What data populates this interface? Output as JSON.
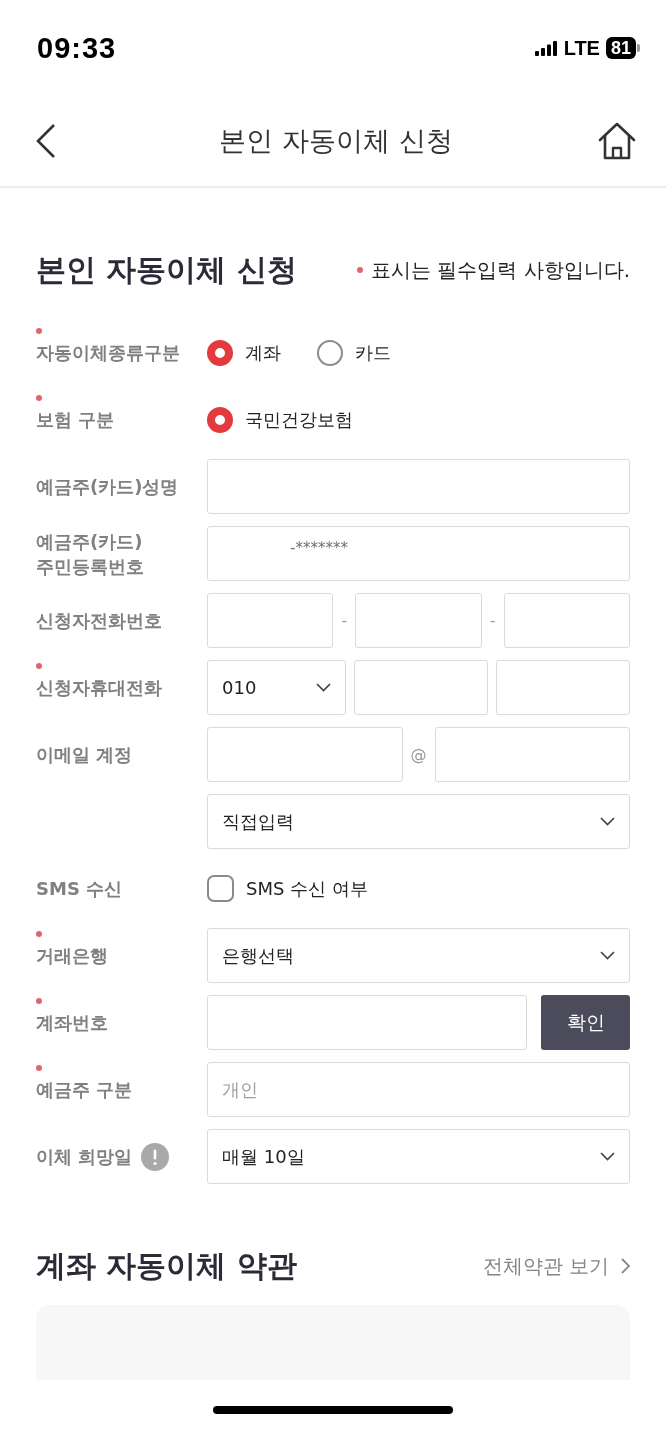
{
  "status_bar": {
    "time": "09:33",
    "network": "LTE",
    "battery": "81"
  },
  "header": {
    "title": "본인 자동이체 신청"
  },
  "form": {
    "title": "본인 자동이체 신청",
    "required_note": "표시는 필수입력 사항입니다.",
    "rows": [
      {
        "kind": "radio",
        "label": "자동이체종류구분",
        "required": true,
        "info": false,
        "options": [
          {
            "label": "계좌",
            "selected": true
          },
          {
            "label": "카드",
            "selected": false
          }
        ]
      },
      {
        "kind": "radio",
        "label": "보험 구분",
        "required": true,
        "info": false,
        "options": [
          {
            "label": "국민건강보험",
            "selected": true
          }
        ]
      },
      {
        "kind": "fields",
        "label": "예금주(카드)성명",
        "required": false,
        "info": false,
        "fields": [
          {
            "kind": "input"
          }
        ]
      },
      {
        "kind": "fields",
        "label": "예금주(카드) 주민등록번호",
        "required": false,
        "info": false,
        "fields": [
          {
            "kind": "input",
            "value": "-*******"
          }
        ]
      },
      {
        "kind": "fields",
        "label": "신청자전화번호",
        "required": false,
        "info": false,
        "fields": [
          {
            "kind": "input"
          },
          {
            "kind": "separator",
            "text": "-"
          },
          {
            "kind": "input"
          },
          {
            "kind": "separator",
            "text": "-"
          },
          {
            "kind": "input"
          }
        ]
      },
      {
        "kind": "fields",
        "label": "신청자휴대전화",
        "required": true,
        "info": false,
        "fields": [
          {
            "kind": "select",
            "value": "010"
          },
          {
            "kind": "input"
          },
          {
            "kind": "input"
          }
        ]
      },
      {
        "kind": "fields",
        "label": "이메일 계정",
        "required": false,
        "info": false,
        "fields": [
          {
            "kind": "input"
          },
          {
            "kind": "separator",
            "text": "@"
          },
          {
            "kind": "input"
          }
        ]
      },
      {
        "kind": "fields",
        "fields": [
          {
            "kind": "select",
            "value": "직접입력"
          }
        ]
      },
      {
        "kind": "checkbox",
        "label": "SMS 수신",
        "required": false,
        "info": false,
        "option": {
          "label": "SMS 수신 여부",
          "checked": false
        }
      },
      {
        "kind": "fields",
        "label": "거래은행",
        "required": true,
        "info": false,
        "fields": [
          {
            "kind": "select",
            "value": "은행선택"
          }
        ]
      },
      {
        "kind": "fields",
        "label": "계좌번호",
        "required": true,
        "info": false,
        "fields": [
          {
            "kind": "input"
          },
          {
            "kind": "button",
            "label": "확인"
          }
        ]
      },
      {
        "kind": "fields",
        "label": "예금주 구분",
        "required": true,
        "info": false,
        "fields": [
          {
            "kind": "input",
            "placeholder": "개인"
          }
        ]
      },
      {
        "kind": "fields",
        "label": "이체 희망일",
        "required": false,
        "info": true,
        "fields": [
          {
            "kind": "select",
            "value": "매월 10일"
          }
        ]
      }
    ]
  },
  "terms": {
    "title": "계좌 자동이체 약관",
    "link": "전체약관 보기"
  }
}
